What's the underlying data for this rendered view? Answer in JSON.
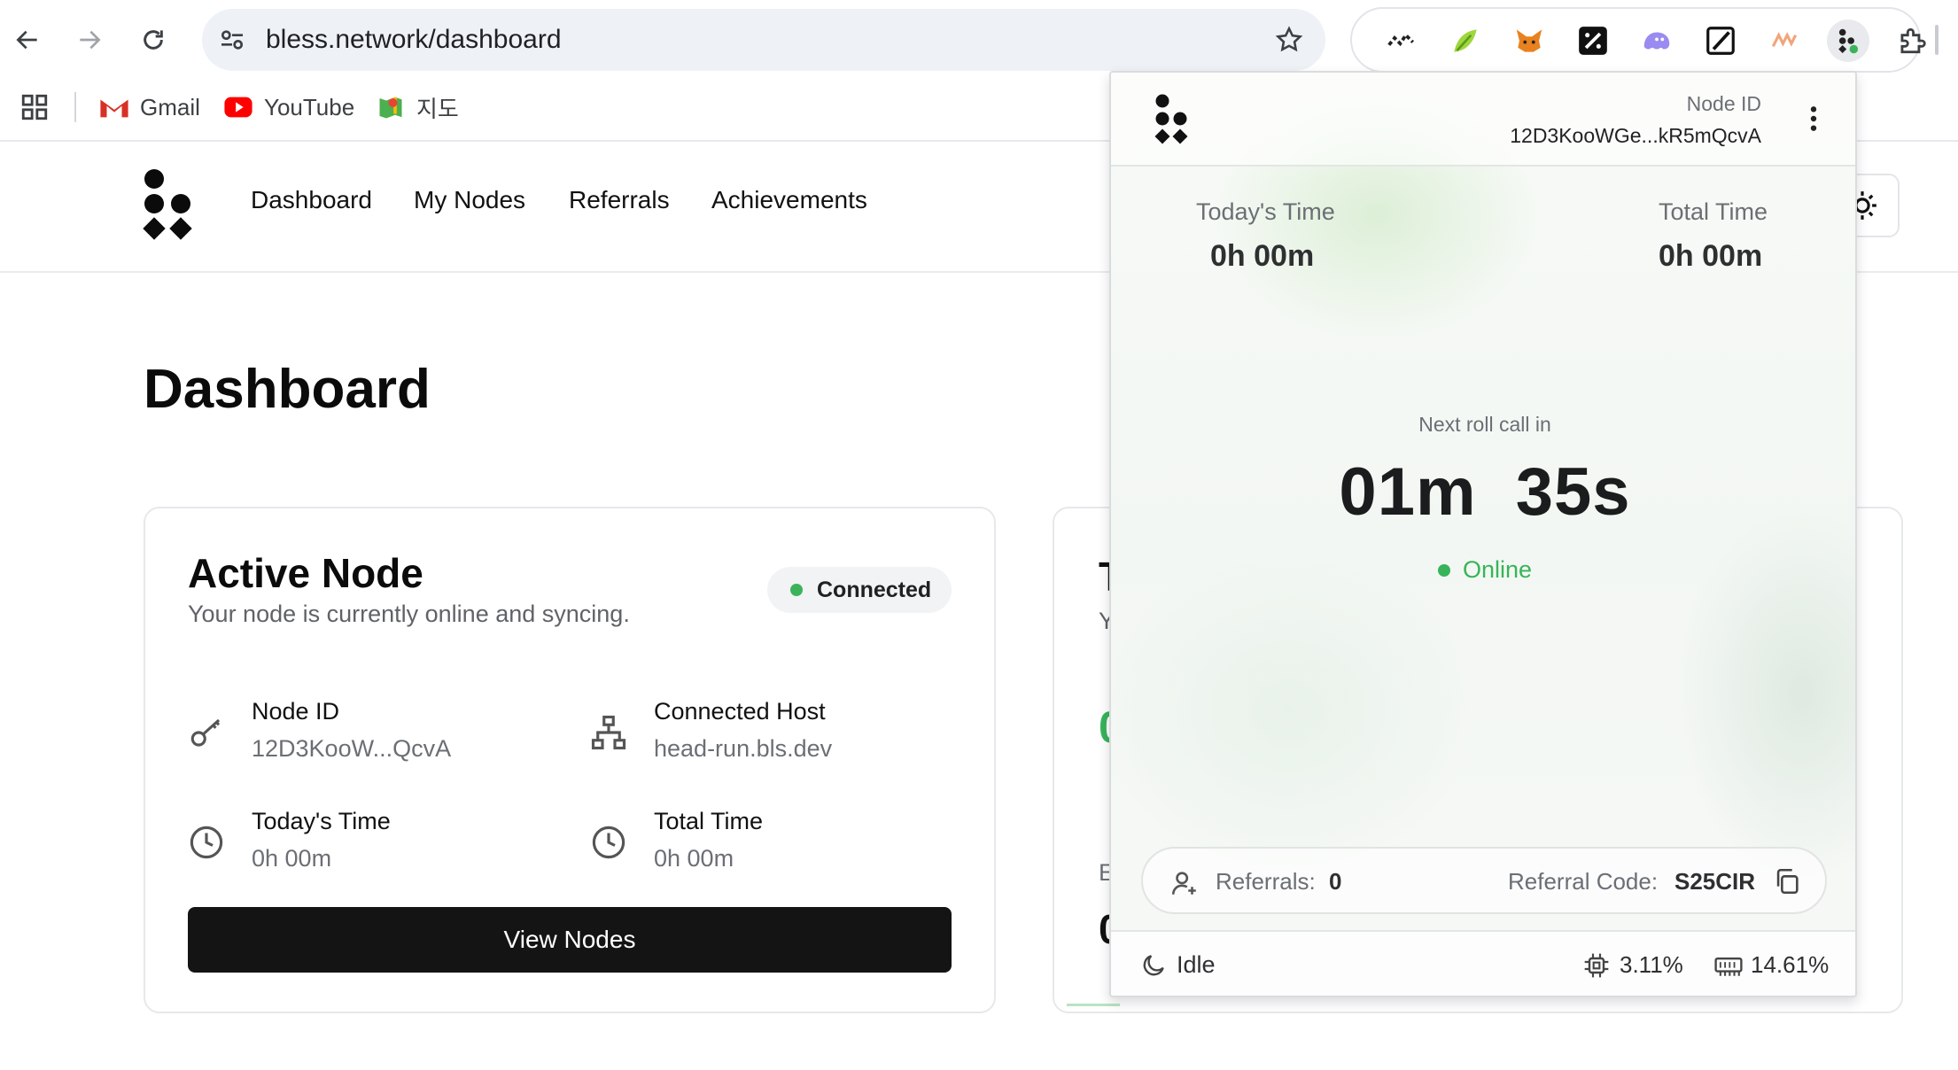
{
  "browser": {
    "url": "bless.network/dashboard",
    "bookmarks": [
      {
        "label": "Gmail",
        "icon": "gmail-icon"
      },
      {
        "label": "YouTube",
        "icon": "youtube-icon"
      },
      {
        "label": "지도",
        "icon": "maps-icon"
      }
    ],
    "extensions": [
      "chart-extension-icon",
      "leaf-extension-icon",
      "metamask-icon",
      "slash-extension-icon",
      "ghost-extension-icon",
      "slash-outline-extension-icon",
      "wave-extension-icon",
      "bless-extension-icon",
      "puzzle-extensions-icon"
    ]
  },
  "site": {
    "nav": [
      "Dashboard",
      "My Nodes",
      "Referrals",
      "Achievements"
    ],
    "page_title": "Dashboard"
  },
  "active_node": {
    "title": "Active Node",
    "subtitle": "Your node is currently online and syncing.",
    "status": "Connected",
    "node_id_label": "Node ID",
    "node_id": "12D3KooW...QcvA",
    "host_label": "Connected Host",
    "host": "head-run.bls.dev",
    "today_label": "Today's Time",
    "today": "0h 00m",
    "total_label": "Total Time",
    "total": "0h 00m",
    "button": "View Nodes"
  },
  "second_card": {
    "title_fragment": "T",
    "sub_fragment": "Y",
    "value_fragment": "0",
    "label_fragment": "E",
    "big_fragment": "0"
  },
  "popup": {
    "node_id_label": "Node ID",
    "node_id": "12D3KooWGe...kR5mQcvA",
    "today_label": "Today's Time",
    "today": "0h 00m",
    "total_label": "Total Time",
    "total": "0h 00m",
    "next_roll_label": "Next roll call in",
    "countdown": "01m  35s",
    "status": "Online",
    "referrals_label": "Referrals:",
    "referrals": "0",
    "referral_code_label": "Referral Code:",
    "referral_code": "S25CIR",
    "mode": "Idle",
    "cpu": "3.11%",
    "ram": "14.61%"
  },
  "colors": {
    "accent_green": "#37b45a",
    "button_dark": "#141414"
  }
}
